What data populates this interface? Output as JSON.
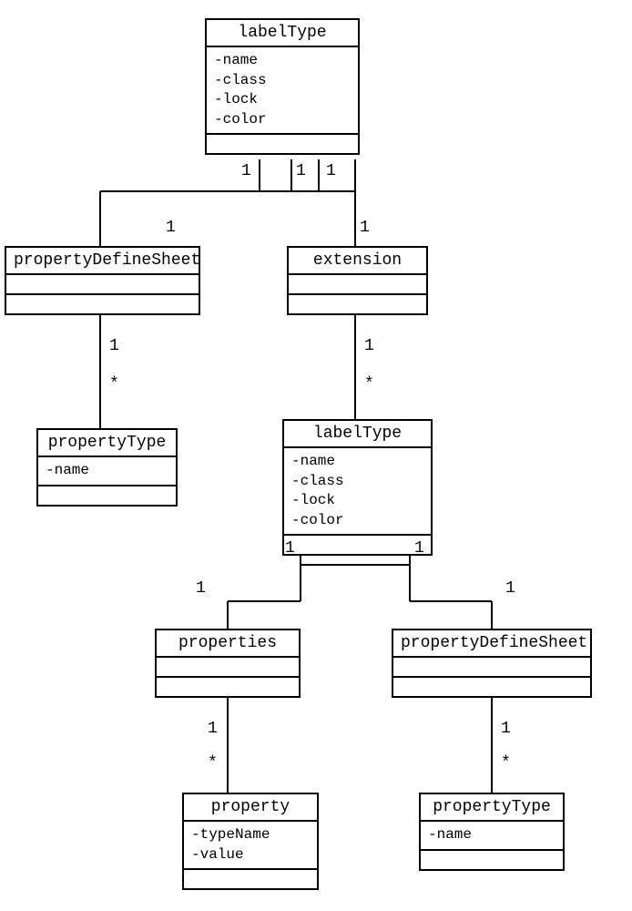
{
  "classes": {
    "labelType1": {
      "name": "labelType",
      "attrs": [
        "-name",
        "-class",
        "-lock",
        "-color"
      ]
    },
    "propertyDefineSheet1": {
      "name": "propertyDefineSheet",
      "attrs": []
    },
    "extension": {
      "name": "extension",
      "attrs": []
    },
    "propertyType1": {
      "name": "propertyType",
      "attrs": [
        "-name"
      ]
    },
    "labelType2": {
      "name": "labelType",
      "attrs": [
        "-name",
        "-class",
        "-lock",
        "-color"
      ]
    },
    "properties": {
      "name": "properties",
      "attrs": []
    },
    "propertyDefineSheet2": {
      "name": "propertyDefineSheet",
      "attrs": []
    },
    "property": {
      "name": "property",
      "attrs": [
        "-typeName",
        "-value"
      ]
    },
    "propertyType2": {
      "name": "propertyType",
      "attrs": [
        "-name"
      ]
    }
  },
  "mult": {
    "one": "1",
    "many": "*"
  },
  "chart_data": {
    "type": "uml-class-diagram",
    "classes": [
      {
        "id": "labelType1",
        "name": "labelType",
        "attributes": [
          "name",
          "class",
          "lock",
          "color"
        ]
      },
      {
        "id": "propertyDefineSheet1",
        "name": "propertyDefineSheet",
        "attributes": []
      },
      {
        "id": "extension",
        "name": "extension",
        "attributes": []
      },
      {
        "id": "propertyType1",
        "name": "propertyType",
        "attributes": [
          "name"
        ]
      },
      {
        "id": "labelType2",
        "name": "labelType",
        "attributes": [
          "name",
          "class",
          "lock",
          "color"
        ]
      },
      {
        "id": "properties",
        "name": "properties",
        "attributes": []
      },
      {
        "id": "propertyDefineSheet2",
        "name": "propertyDefineSheet",
        "attributes": []
      },
      {
        "id": "property",
        "name": "property",
        "attributes": [
          "typeName",
          "value"
        ]
      },
      {
        "id": "propertyType2",
        "name": "propertyType",
        "attributes": [
          "name"
        ]
      }
    ],
    "associations": [
      {
        "from": "labelType1",
        "to": "propertyDefineSheet1",
        "fromMult": "1",
        "toMult": "1"
      },
      {
        "from": "labelType1",
        "to": "extension",
        "fromMult": "1",
        "toMult": "1"
      },
      {
        "from": "propertyDefineSheet1",
        "to": "propertyType1",
        "fromMult": "1",
        "toMult": "*"
      },
      {
        "from": "extension",
        "to": "labelType2",
        "fromMult": "1",
        "toMult": "*"
      },
      {
        "from": "labelType2",
        "to": "properties",
        "fromMult": "1",
        "toMult": "1"
      },
      {
        "from": "labelType2",
        "to": "propertyDefineSheet2",
        "fromMult": "1",
        "toMult": "1"
      },
      {
        "from": "properties",
        "to": "property",
        "fromMult": "1",
        "toMult": "*"
      },
      {
        "from": "propertyDefineSheet2",
        "to": "propertyType2",
        "fromMult": "1",
        "toMult": "*"
      }
    ]
  }
}
